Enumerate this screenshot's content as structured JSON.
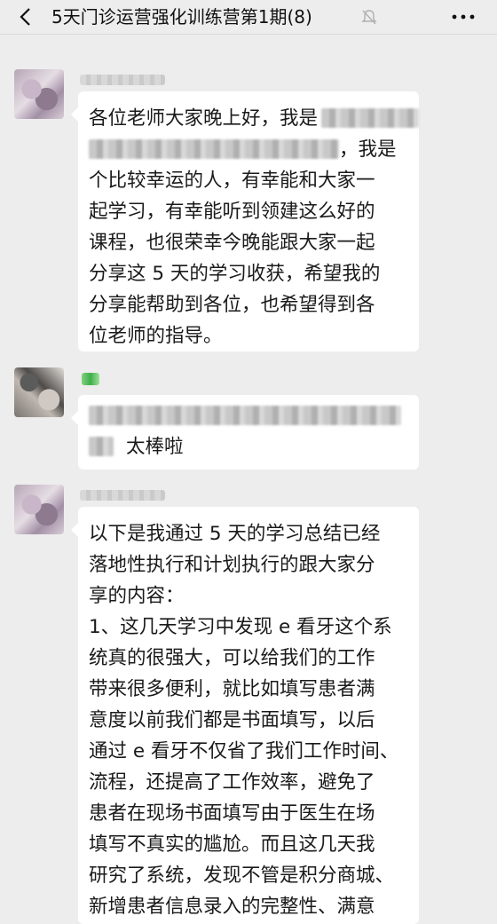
{
  "header": {
    "title": "5天门诊运营强化训练营第1期(8)"
  },
  "messages": [
    {
      "lines": [
        "各位老师大家晚上好，我是",
        "，我是",
        "个比较幸运的人，有幸能和大家一",
        "起学习，有幸能听到领建这么好的",
        "课程，也很荣幸今晚能跟大家一起",
        "分享这 5 天的学习收获，希望我的",
        "分享能帮助到各位，也希望得到各",
        "位老师的指导。"
      ]
    },
    {
      "text": "太棒啦"
    },
    {
      "lines": [
        "以下是我通过 5 天的学习总结已经",
        "落地性执行和计划执行的跟大家分",
        "享的内容：",
        "1、这几天学习中发现 e 看牙这个系",
        "统真的很强大，可以给我们的工作",
        "带来很多便利，就比如填写患者满",
        "意度以前我们都是书面填写，以后",
        "通过 e 看牙不仅省了我们工作时间、",
        "流程，还提高了工作效率，避免了",
        "患者在现场书面填写由于医生在场",
        "填写不真实的尴尬。而且这几天我",
        "研究了系统，发现不管是积分商城、",
        "新增患者信息录入的完整性、满意"
      ]
    }
  ]
}
